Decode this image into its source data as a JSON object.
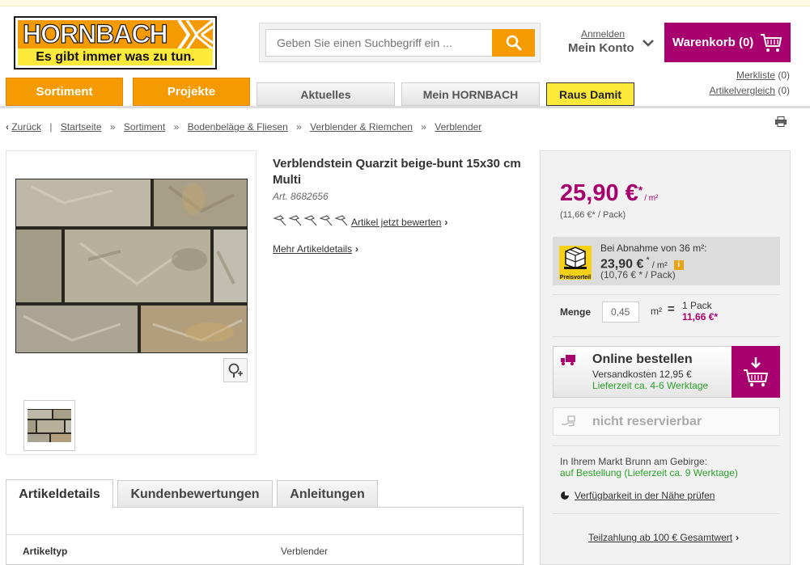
{
  "header": {
    "logo_main": "HORNBACH",
    "logo_slogan": "Es gibt immer was zu tun.",
    "search": {
      "placeholder": "Geben Sie einen Suchbegriff ein ..."
    },
    "account": {
      "login": "Anmelden",
      "title": "Mein Konto"
    },
    "cart": {
      "label": "Warenkorb (0)"
    },
    "merkliste": {
      "label": "Merkliste",
      "count": "(0)"
    },
    "vergleich": {
      "label": "Artikelvergleich",
      "count": "(0)"
    }
  },
  "nav": {
    "tabs": [
      {
        "label": "Sortiment"
      },
      {
        "label": "Projekte"
      },
      {
        "label": "Aktuelles"
      },
      {
        "label": "Mein HORNBACH"
      },
      {
        "label": "Raus Damit"
      }
    ]
  },
  "breadcrumb": {
    "back": "Zurück",
    "items": [
      "Startseite",
      "Sortiment",
      "Bodenbeläge & Fliesen",
      "Verblender & Riemchen",
      "Verblender"
    ]
  },
  "product": {
    "title": "Verblendstein Quarzit beige-bunt 15x30 cm Multi",
    "art_nr": "Art. 8682656",
    "rating_link": "Artikel jetzt bewerten",
    "details_link": "Mehr Artikeldetails"
  },
  "buy": {
    "price": "25,90 €",
    "price_sup": "*",
    "price_unit": "/ m²",
    "pack_price": "(11,66 €* / Pack)",
    "preisvorteil": {
      "badge": "Preisvorteil",
      "line1": "Bei Abnahme von 36 m²:",
      "price": "23,90 €",
      "sup": " * ",
      "unit": "/ m²",
      "pack": "(10,76 € * / Pack)"
    },
    "menge": {
      "label": "Menge",
      "value": "0,45",
      "unit": "m²",
      "eq": "=",
      "packs": "1 Pack",
      "total": "11,66 €*"
    },
    "online": {
      "title": "Online bestellen",
      "shipping": "Versandkosten 12,95 €",
      "delivery": "Lieferzeit ca. 4-6 Werktage"
    },
    "reserve": {
      "label": "nicht reservierbar"
    },
    "markt": {
      "line1": "In Ihrem Markt Brunn am Gebirge:",
      "line2": "auf Bestellung (Lieferzeit ca. 9 Werktage)"
    },
    "availability_link": "Verfügbarkeit in der Nähe prüfen",
    "installment_link": "Teilzahlung ab 100 € Gesamtwert"
  },
  "detail_tabs": [
    {
      "label": "Artikeldetails"
    },
    {
      "label": "Kundenbewertungen"
    },
    {
      "label": "Anleitungen"
    }
  ],
  "specs": [
    {
      "key": "Artikeltyp",
      "value": "Verblender"
    }
  ],
  "colors": {
    "brand_orange": "#f59a00",
    "cart_magenta": "#a8006e",
    "raus_yellow": "#fde93a",
    "green": "#2aa12a"
  }
}
